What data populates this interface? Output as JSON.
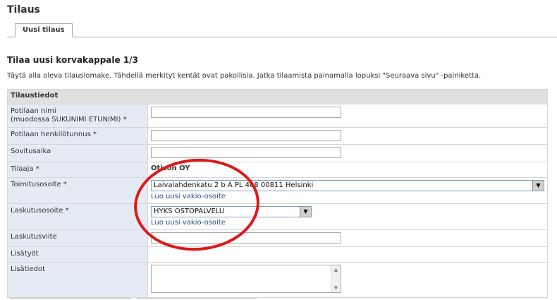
{
  "page": {
    "title": "Tilaus"
  },
  "tabs": [
    {
      "label": "Uusi tilaus",
      "active": true
    }
  ],
  "section": {
    "title": "Tilaa uusi korvakappale 1/3",
    "intro": "Täytä alla oleva tilauslomake. Tähdellä merkityt kentät ovat pakollisia. Jatka tilaamista painamalla lopuksi \"Seuraava sivu\" -painiketta."
  },
  "form": {
    "header": "Tilaustiedot",
    "rows": {
      "patient_name": {
        "label_line1": "Potilaan nimi",
        "label_line2": "(muodossa SUKUNIMI ETUNIMI) *",
        "value": ""
      },
      "patient_id": {
        "label": "Potilaan henkilötunnus *",
        "value": ""
      },
      "fitting_time": {
        "label": "Sovitusaika",
        "value": ""
      },
      "orderer": {
        "label": "Tilaaja *",
        "value": "Oticon OY"
      },
      "delivery_address": {
        "label": "Toimitusosoite *",
        "selected": "Laivalahdenkatu 2 b A PL 408 00811 Helsinki",
        "link": "Luo uusi vakio-osoite"
      },
      "billing_address": {
        "label": "Laskutusosoite *",
        "selected": "HYKS OSTOPALVELU",
        "link": "Luo uusi vakio-osoite"
      },
      "billing_reference": {
        "label": "Laskutusviite",
        "value": ""
      },
      "extra_work": {
        "label": "Lisätyöt"
      },
      "extra_info": {
        "label": "Lisätiedot",
        "value": ""
      }
    }
  },
  "colors": {
    "annotation": "#e01818",
    "label_background": "#e4ebf5",
    "link": "#1f4e8c"
  },
  "icons": {
    "dropdown": "chevron-down-icon",
    "scroll_up": "scroll-up-icon",
    "scroll_down": "scroll-down-icon"
  }
}
